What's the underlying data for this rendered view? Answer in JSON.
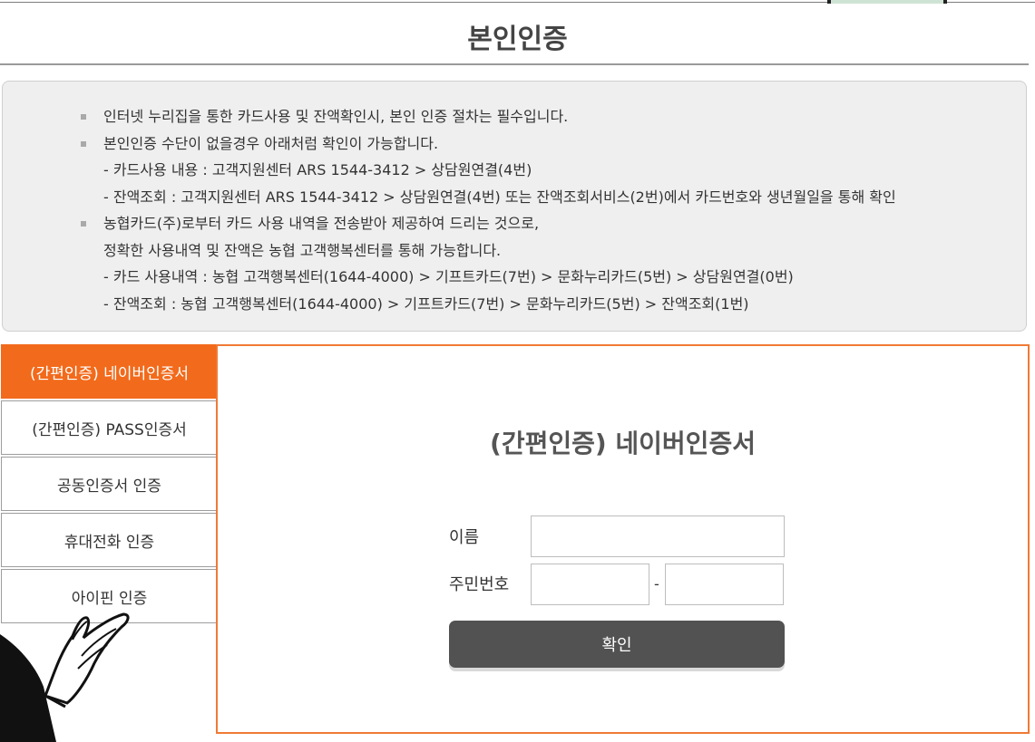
{
  "page": {
    "title": "본인인증"
  },
  "notice": {
    "items": [
      {
        "type": "bullet",
        "text": "인터넷 누리집을 통한 카드사용 및 잔액확인시, 본인 인증 절차는 필수입니다."
      },
      {
        "type": "bullet",
        "text": "본인인증 수단이 없을경우 아래처럼 확인이 가능합니다."
      },
      {
        "type": "sub",
        "text": "- 카드사용 내용 : 고객지원센터 ARS 1544-3412 > 상담원연결(4번)"
      },
      {
        "type": "sub",
        "text": "- 잔액조회 : 고객지원센터 ARS 1544-3412 > 상담원연결(4번) 또는 잔액조회서비스(2번)에서 카드번호와 생년월일을 통해 확인"
      },
      {
        "type": "bullet",
        "text": "농협카드(주)로부터 카드 사용 내역을 전송받아 제공하여 드리는 것으로,"
      },
      {
        "type": "sub",
        "text": "정확한 사용내역 및 잔액은 농협 고객행복센터를 통해 가능합니다."
      },
      {
        "type": "sub",
        "text": "- 카드 사용내역 : 농협 고객행복센터(1644-4000) > 기프트카드(7번) > 문화누리카드(5번) > 상담원연결(0번)"
      },
      {
        "type": "sub",
        "text": "- 잔액조회 : 농협 고객행복센터(1644-4000) > 기프트카드(7번) > 문화누리카드(5번) > 잔액조회(1번)"
      }
    ]
  },
  "auth_tabs": [
    {
      "label": "(간편인증) 네이버인증서",
      "active": true
    },
    {
      "label": "(간편인증) PASS인증서",
      "active": false
    },
    {
      "label": "공동인증서 인증",
      "active": false
    },
    {
      "label": "휴대전화 인증",
      "active": false
    },
    {
      "label": "아이핀 인증",
      "active": false
    }
  ],
  "form": {
    "title": "(간편인증) 네이버인증서",
    "name_label": "이름",
    "name_value": "",
    "rrn_label": "주민번호",
    "rrn_front_value": "",
    "rrn_separator": "-",
    "rrn_back_value": "",
    "confirm_label": "확인"
  },
  "colors": {
    "accent": "#f26a1b",
    "panel_border": "#f07a35",
    "button": "#525252",
    "notice_bg": "#efefef"
  }
}
